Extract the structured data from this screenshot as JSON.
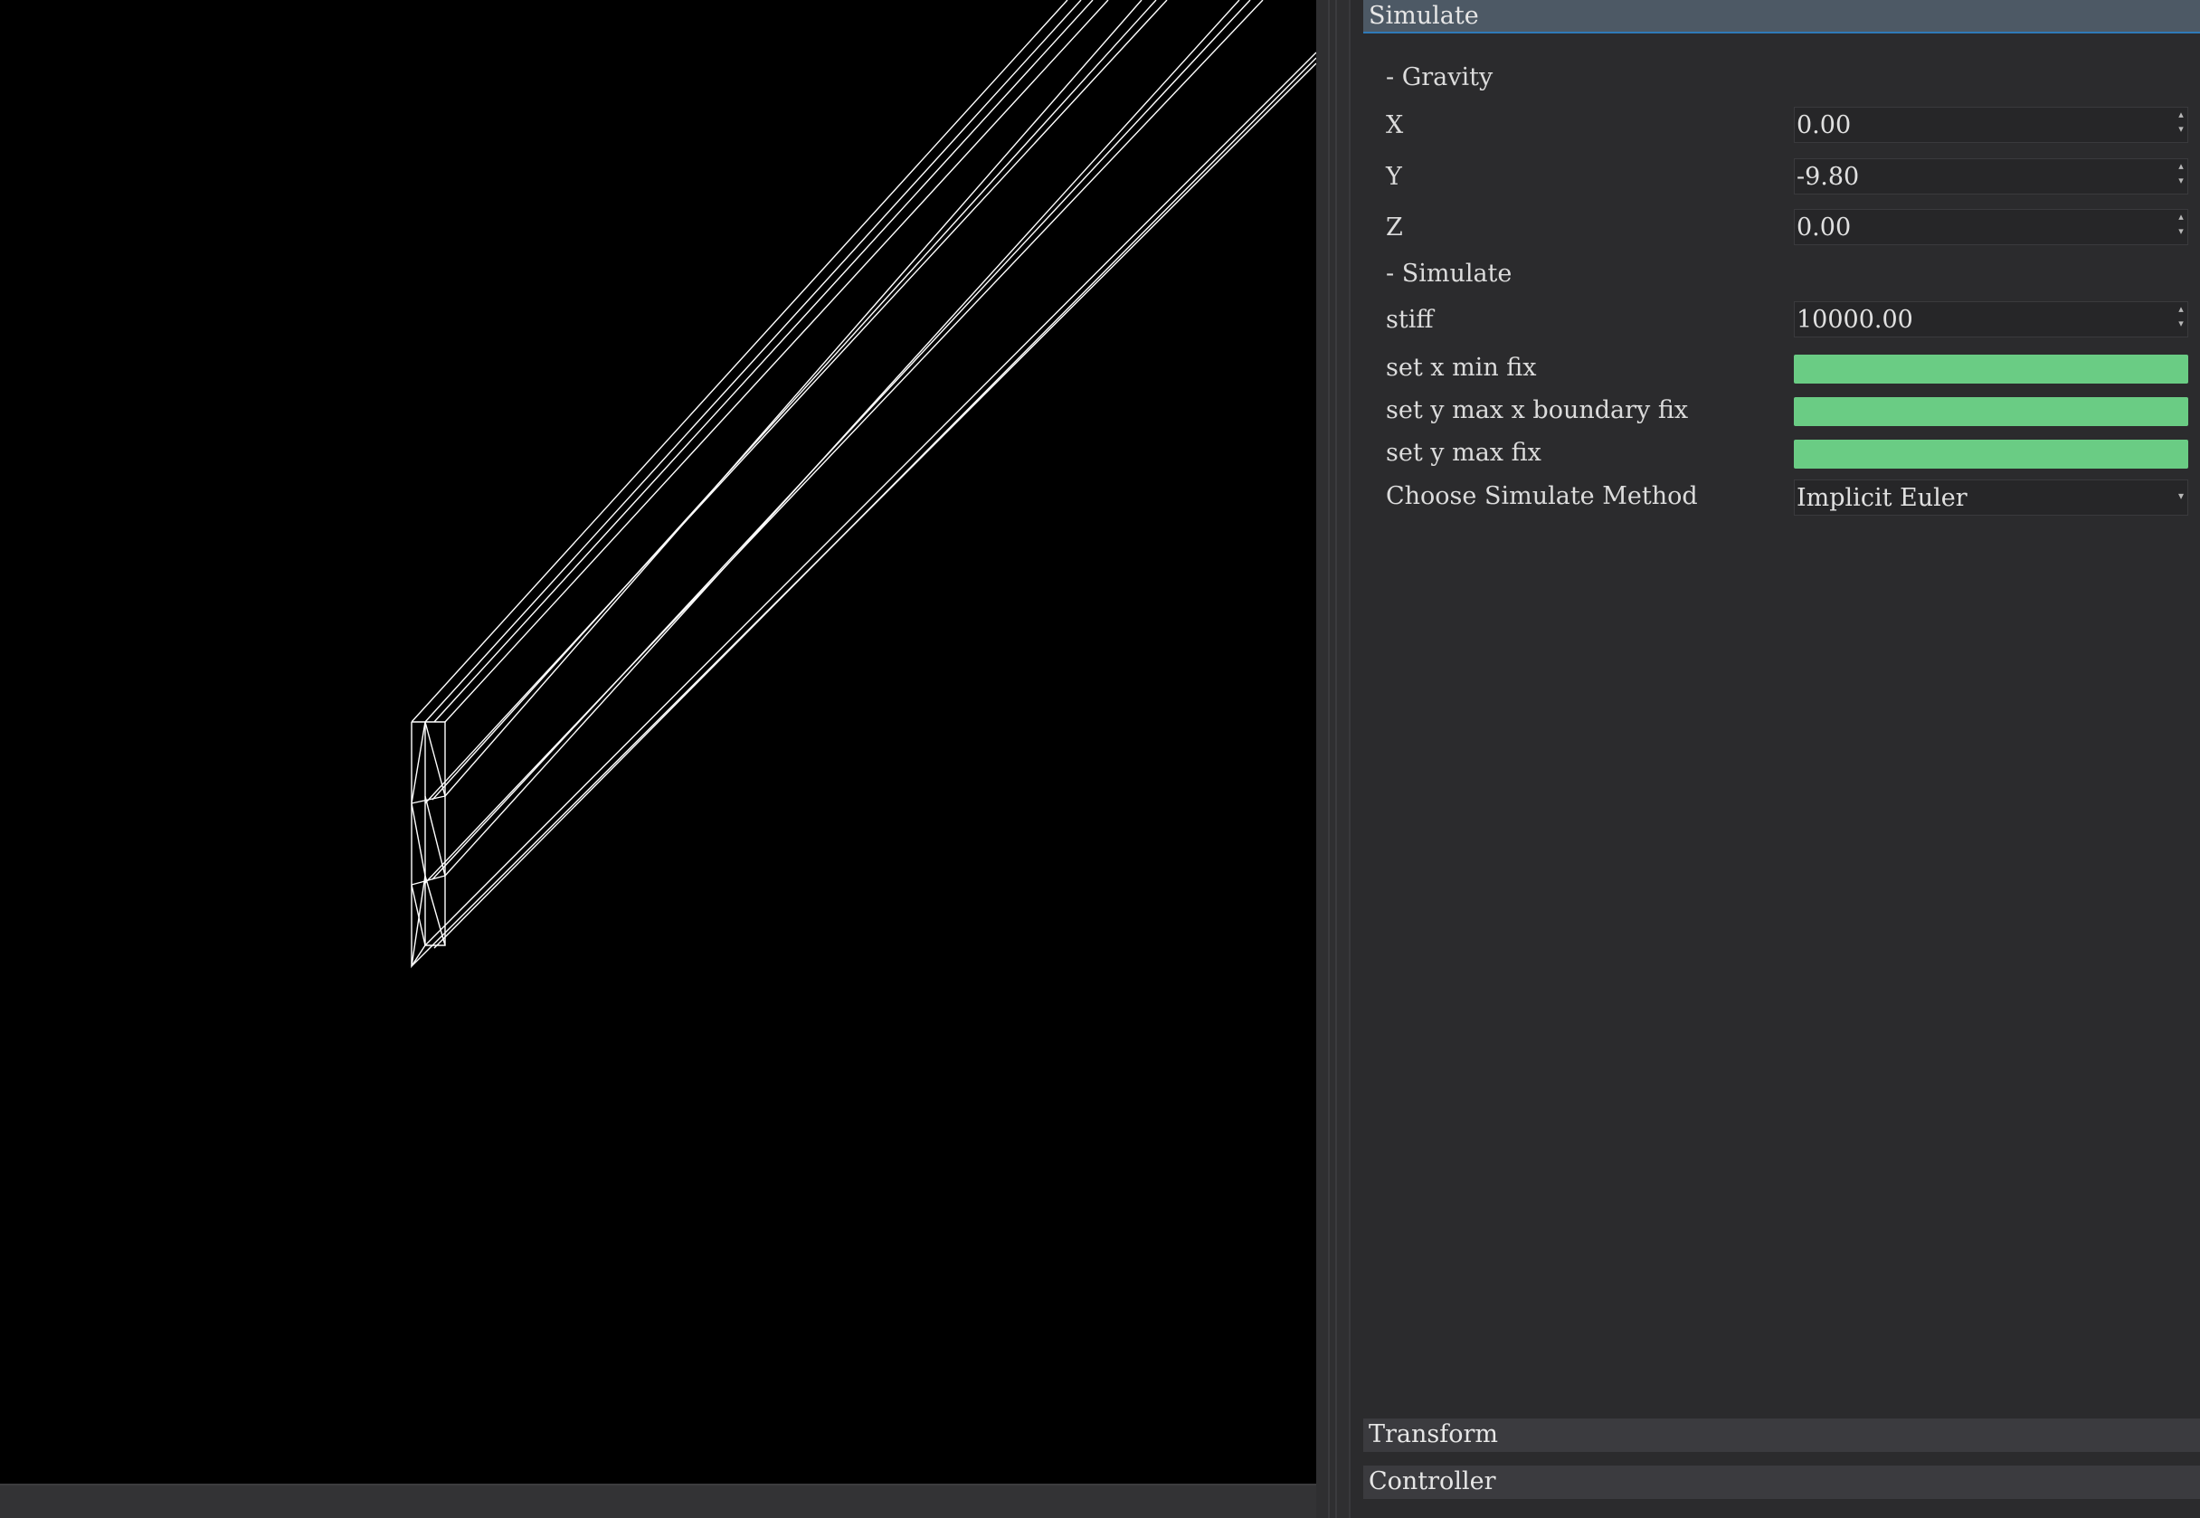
{
  "panel": {
    "sections": {
      "simulate": {
        "title": "Simulate"
      },
      "transform": {
        "title": "Transform"
      },
      "controller": {
        "title": "Controller"
      }
    },
    "gravity": {
      "group_label": "- Gravity",
      "x": {
        "label": "X",
        "value": "0.00"
      },
      "y": {
        "label": "Y",
        "value": "-9.80"
      },
      "z": {
        "label": "Z",
        "value": "0.00"
      }
    },
    "simulate_group": {
      "group_label": "- Simulate",
      "stiff": {
        "label": "stiff",
        "value": "10000.00"
      },
      "set_x_min_fix": {
        "label": "set x min fix",
        "checked": true
      },
      "set_y_max_x_boundary_fix": {
        "label": "set y max x boundary fix",
        "checked": true
      },
      "set_y_max_fix": {
        "label": "set y max fix",
        "checked": true
      },
      "method": {
        "label": "Choose Simulate Method",
        "value": "Implicit Euler"
      }
    }
  },
  "colors": {
    "viewport_bg": "#000000",
    "wireframe": "#ffffff",
    "toggle_on": "#6acc84",
    "header_active": "#4d5965",
    "header_inactive": "#3b3b3f",
    "panel_bg": "#2b2b2d"
  },
  "icons": {
    "spin_up": "spin-up-arrow-icon",
    "spin_down": "spin-down-arrow-icon",
    "combo_caret": "chevron-down-icon"
  }
}
